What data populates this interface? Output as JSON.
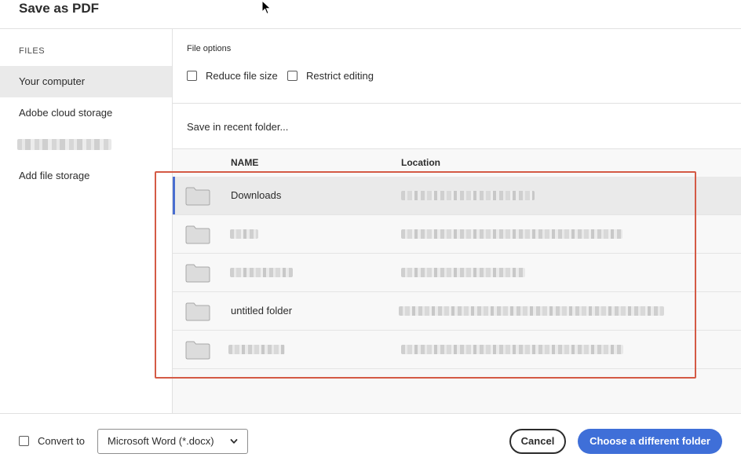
{
  "dialog": {
    "title": "Save as PDF"
  },
  "sidebar": {
    "heading": "FILES",
    "items": [
      {
        "label": "Your computer"
      },
      {
        "label": "Adobe cloud storage"
      },
      {
        "label": "Add file storage"
      }
    ]
  },
  "main": {
    "file_options_label": "File options",
    "options": [
      {
        "label": "Reduce file size",
        "checked": false
      },
      {
        "label": "Restrict editing",
        "checked": false
      }
    ],
    "recent_label": "Save in recent folder...",
    "columns": {
      "name": "NAME",
      "location": "Location"
    },
    "rows": [
      {
        "name": "Downloads",
        "location": ""
      },
      {
        "name": "",
        "location": ""
      },
      {
        "name": "",
        "location": ""
      },
      {
        "name": "untitled folder",
        "location": ""
      },
      {
        "name": "",
        "location": ""
      }
    ]
  },
  "footer": {
    "convert_label": "Convert to",
    "format_selected": "Microsoft Word (*.docx)",
    "cancel_label": "Cancel",
    "primary_label": "Choose a different folder"
  },
  "colors": {
    "accent": "#3f6fd8",
    "selected_indicator": "#4a6ed0",
    "annotation_box": "#d45a45"
  },
  "icons": [
    "cursor-icon",
    "folder-icon",
    "chevron-down-icon",
    "checkbox-icon"
  ]
}
